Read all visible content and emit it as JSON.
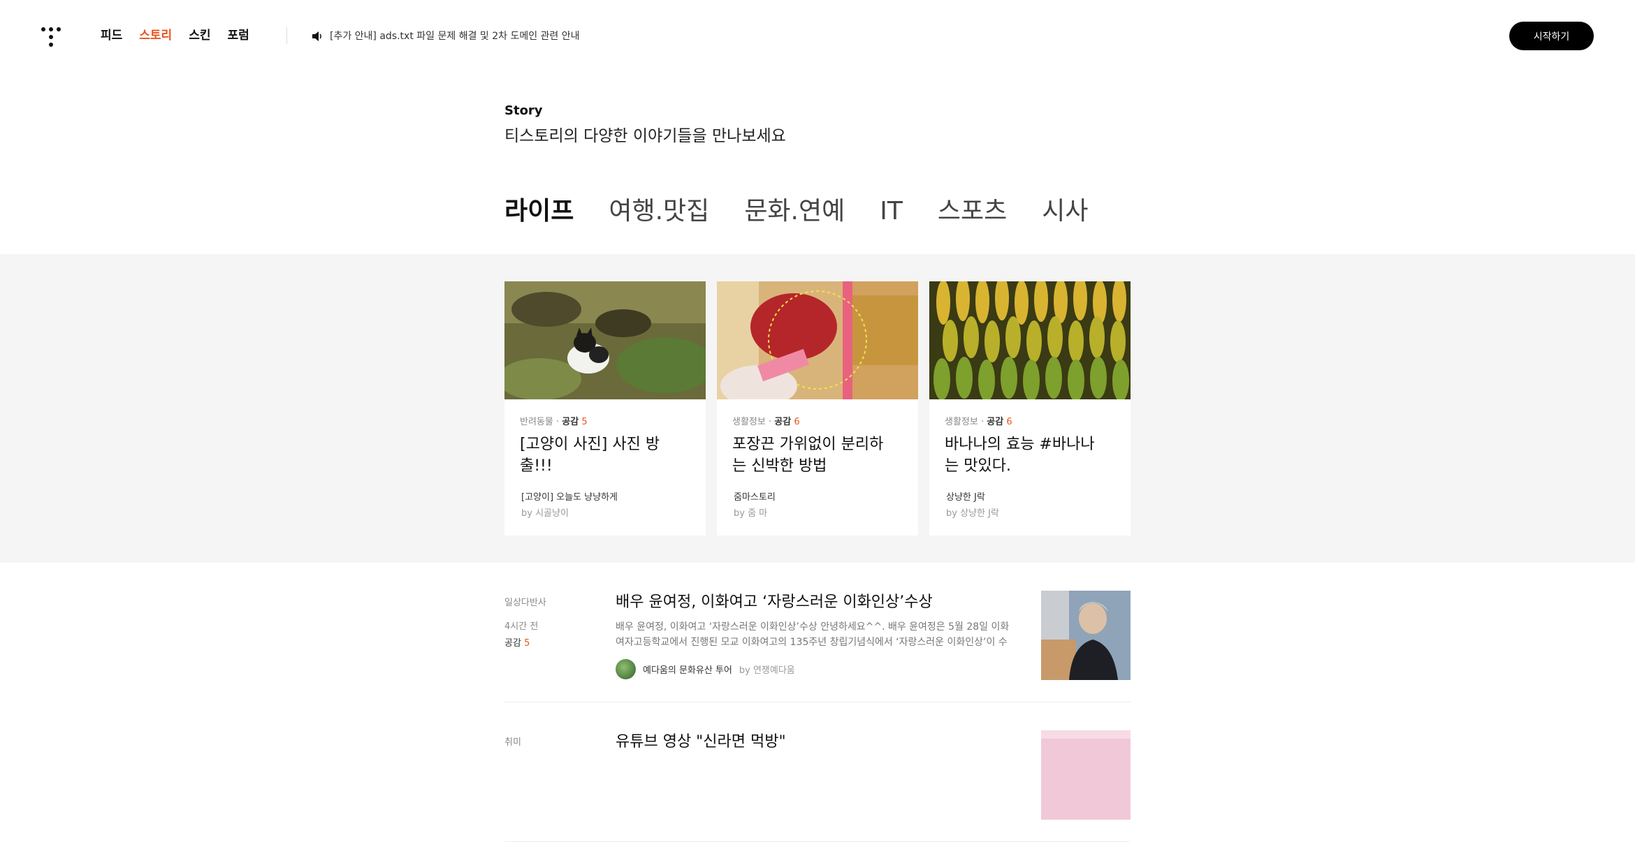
{
  "nav": {
    "items": [
      "피드",
      "스토리",
      "스킨",
      "포럼"
    ],
    "active": "스토리"
  },
  "notice": {
    "text": "[추가 안내] ads.txt 파일 문제 해결 및 2차 도메인 관련 안내"
  },
  "start_button": "시작하기",
  "intro": {
    "title": "Story",
    "subtitle": "티스토리의 다양한 이야기들을 만나보세요"
  },
  "categories": [
    "라이프",
    "여행.맛집",
    "문화.연예",
    "IT",
    "스포츠",
    "시사"
  ],
  "cards": [
    {
      "category": "반려동물",
      "like_label": "공감",
      "likes": "5",
      "title": "[고양이 사진] 사진 방출!!!",
      "blog": "[고양이] 오늘도 냥냥하게",
      "author": "by 시골냥이"
    },
    {
      "category": "생활정보",
      "like_label": "공감",
      "likes": "6",
      "title": "포장끈 가위없이 분리하는 신박한 방법",
      "blog": "줌마스토리",
      "author": "by 줌 마"
    },
    {
      "category": "생활정보",
      "like_label": "공감",
      "likes": "6",
      "title": "바나나의 효능 #바나나는 맛있다.",
      "blog": "상냥한 J락",
      "author": "by 상냥한 J락"
    }
  ],
  "list": [
    {
      "category": "일상다반사",
      "time": "4시간 전",
      "like_label": "공감",
      "likes": "5",
      "title": "배우 윤여정, 이화여고 ‘자랑스러운 이화인상’수상",
      "summary": "배우 윤여정, 이화여고 ‘자랑스러운 이화인상’수상 안녕하세요^^. 배우 윤여정은 5월 28일 이화여자고등학교에서 진행된 모교 이화여고의 135주년 창립기념식에서 ‘자랑스러운 이화인상’이 수상했...",
      "blog": "예다움의 문화유산 투어",
      "author": "by 연쟁예다움"
    },
    {
      "category": "취미",
      "title": "유튜브 영상 \"신라면 먹방\""
    }
  ]
}
